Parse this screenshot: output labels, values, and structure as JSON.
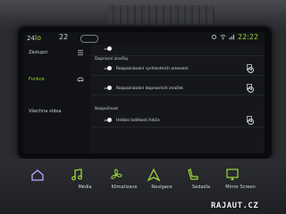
{
  "status_bar": {
    "temp_left": "24",
    "temp_left_fan": "lo",
    "temp_right": "22",
    "clock": "22:22"
  },
  "nav": {
    "items": [
      {
        "label": "Zástupci"
      },
      {
        "label": "Funkce"
      },
      {
        "label": "Všechna videa"
      }
    ]
  },
  "list": {
    "rows": [
      {
        "label": "Rozpoznávání rychlostních omezení"
      },
      {
        "label": "Rozpoznávání dopravních značek"
      },
      {
        "label": "Hlídání bdělosti řidiče"
      }
    ],
    "sections": [
      "Dopravní značky",
      "Bezpečnost"
    ]
  },
  "bottom": {
    "tiles": [
      {
        "label": ""
      },
      {
        "label": "Média"
      },
      {
        "label": "Klimatizace"
      },
      {
        "label": "Navigace"
      },
      {
        "label": "Sedadla"
      },
      {
        "label": "Mirror Screen"
      }
    ]
  },
  "watermark": "RAJAUT.CZ",
  "colors": {
    "accent": "#9fd43a",
    "bg": "#111316"
  }
}
